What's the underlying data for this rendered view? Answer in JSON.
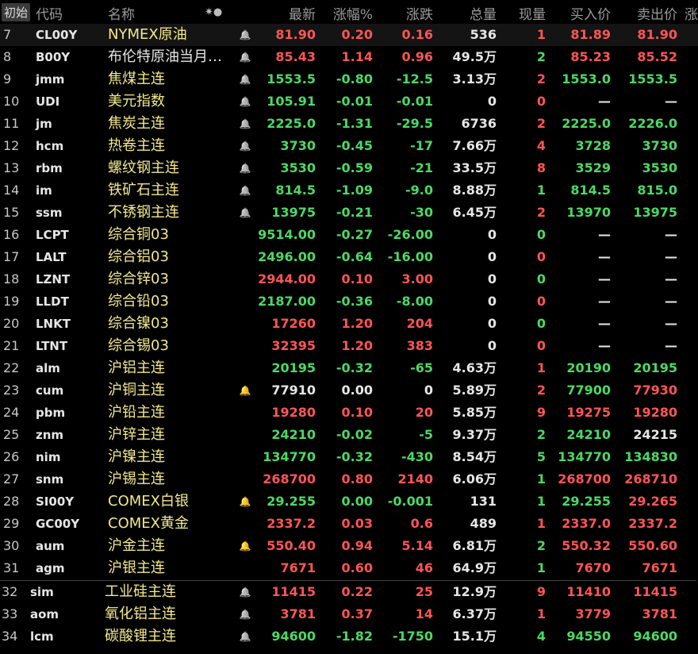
{
  "header": {
    "tag": "初始",
    "code": "代码",
    "name": "名称",
    "star": "✷●",
    "last": "最新",
    "pct": "涨幅%",
    "chg": "涨跌",
    "vol": "总量",
    "cur": "现量",
    "bid": "买入价",
    "ask": "卖出价",
    "extra": "涨"
  },
  "colors": {
    "up": "#ff5555",
    "down": "#4cd964",
    "flat": "#e6e6e6",
    "name_highlight": "#f3e98a",
    "bell_active": "#ff4422",
    "bell_idle": "#888888"
  },
  "rows": [
    {
      "idx": "7",
      "code": "CL00Y",
      "name": "NYMEX原油",
      "name_color": "yellow",
      "bell": "idle",
      "last": "81.90",
      "last_c": "red",
      "pct": "0.20",
      "pct_c": "red",
      "chg": "0.16",
      "chg_c": "red",
      "vol": "536",
      "cur": "1",
      "cur_c": "red",
      "bid": "81.89",
      "bid_c": "red",
      "ask": "81.90",
      "ask_c": "red"
    },
    {
      "idx": "8",
      "code": "B00Y",
      "name": "布伦特原油当月…",
      "name_color": "white",
      "bell": "idle",
      "last": "85.43",
      "last_c": "red",
      "pct": "1.14",
      "pct_c": "red",
      "chg": "0.96",
      "chg_c": "red",
      "vol": "49.5万",
      "cur": "2",
      "cur_c": "green",
      "bid": "85.23",
      "bid_c": "red",
      "ask": "85.52",
      "ask_c": "red"
    },
    {
      "idx": "9",
      "code": "jmm",
      "name": "焦煤主连",
      "name_color": "yellow",
      "bell": "idle",
      "last": "1553.5",
      "last_c": "green",
      "pct": "-0.80",
      "pct_c": "green",
      "chg": "-12.5",
      "chg_c": "green",
      "vol": "3.13万",
      "cur": "2",
      "cur_c": "red",
      "bid": "1553.0",
      "bid_c": "green",
      "ask": "1553.5",
      "ask_c": "green"
    },
    {
      "idx": "10",
      "code": "UDI",
      "name": "美元指数",
      "name_color": "yellow",
      "bell": "idle",
      "last": "105.91",
      "last_c": "green",
      "pct": "-0.01",
      "pct_c": "green",
      "chg": "-0.01",
      "chg_c": "green",
      "vol": "0",
      "cur": "0",
      "cur_c": "red",
      "bid": "—",
      "bid_c": "white",
      "ask": "—",
      "ask_c": "white"
    },
    {
      "idx": "11",
      "code": "jm",
      "name": "焦炭主连",
      "name_color": "yellow",
      "bell": "idle",
      "last": "2225.0",
      "last_c": "green",
      "pct": "-1.31",
      "pct_c": "green",
      "chg": "-29.5",
      "chg_c": "green",
      "vol": "6736",
      "cur": "2",
      "cur_c": "red",
      "bid": "2225.0",
      "bid_c": "green",
      "ask": "2226.0",
      "ask_c": "green"
    },
    {
      "idx": "12",
      "code": "hcm",
      "name": "热卷主连",
      "name_color": "yellow",
      "bell": "idle",
      "last": "3730",
      "last_c": "green",
      "pct": "-0.45",
      "pct_c": "green",
      "chg": "-17",
      "chg_c": "green",
      "vol": "7.66万",
      "cur": "4",
      "cur_c": "red",
      "bid": "3728",
      "bid_c": "green",
      "ask": "3730",
      "ask_c": "green"
    },
    {
      "idx": "13",
      "code": "rbm",
      "name": "螺纹钢主连",
      "name_color": "yellow",
      "bell": "idle",
      "last": "3530",
      "last_c": "green",
      "pct": "-0.59",
      "pct_c": "green",
      "chg": "-21",
      "chg_c": "green",
      "vol": "33.5万",
      "cur": "8",
      "cur_c": "red",
      "bid": "3529",
      "bid_c": "green",
      "ask": "3530",
      "ask_c": "green"
    },
    {
      "idx": "14",
      "code": "im",
      "name": "铁矿石主连",
      "name_color": "yellow",
      "bell": "idle",
      "last": "814.5",
      "last_c": "green",
      "pct": "-1.09",
      "pct_c": "green",
      "chg": "-9.0",
      "chg_c": "green",
      "vol": "8.88万",
      "cur": "1",
      "cur_c": "green",
      "bid": "814.5",
      "bid_c": "green",
      "ask": "815.0",
      "ask_c": "green"
    },
    {
      "idx": "15",
      "code": "ssm",
      "name": "不锈钢主连",
      "name_color": "yellow",
      "bell": "idle",
      "last": "13975",
      "last_c": "green",
      "pct": "-0.21",
      "pct_c": "green",
      "chg": "-30",
      "chg_c": "green",
      "vol": "6.45万",
      "cur": "2",
      "cur_c": "red",
      "bid": "13970",
      "bid_c": "green",
      "ask": "13975",
      "ask_c": "green"
    },
    {
      "idx": "16",
      "code": "LCPT",
      "name": "综合铜03",
      "name_color": "yellow",
      "bell": "none",
      "last": "9514.00",
      "last_c": "green",
      "pct": "-0.27",
      "pct_c": "green",
      "chg": "-26.00",
      "chg_c": "green",
      "vol": "0",
      "cur": "0",
      "cur_c": "green",
      "bid": "—",
      "bid_c": "white",
      "ask": "—",
      "ask_c": "white"
    },
    {
      "idx": "17",
      "code": "LALT",
      "name": "综合铝03",
      "name_color": "yellow",
      "bell": "none",
      "last": "2496.00",
      "last_c": "green",
      "pct": "-0.64",
      "pct_c": "green",
      "chg": "-16.00",
      "chg_c": "green",
      "vol": "0",
      "cur": "0",
      "cur_c": "red",
      "bid": "—",
      "bid_c": "white",
      "ask": "—",
      "ask_c": "white"
    },
    {
      "idx": "18",
      "code": "LZNT",
      "name": "综合锌03",
      "name_color": "yellow",
      "bell": "none",
      "last": "2944.00",
      "last_c": "red",
      "pct": "0.10",
      "pct_c": "red",
      "chg": "3.00",
      "chg_c": "red",
      "vol": "0",
      "cur": "0",
      "cur_c": "green",
      "bid": "—",
      "bid_c": "white",
      "ask": "—",
      "ask_c": "white"
    },
    {
      "idx": "19",
      "code": "LLDT",
      "name": "综合铅03",
      "name_color": "yellow",
      "bell": "none",
      "last": "2187.00",
      "last_c": "green",
      "pct": "-0.36",
      "pct_c": "green",
      "chg": "-8.00",
      "chg_c": "green",
      "vol": "0",
      "cur": "0",
      "cur_c": "red",
      "bid": "—",
      "bid_c": "white",
      "ask": "—",
      "ask_c": "white"
    },
    {
      "idx": "20",
      "code": "LNKT",
      "name": "综合镍03",
      "name_color": "yellow",
      "bell": "none",
      "last": "17260",
      "last_c": "red",
      "pct": "1.20",
      "pct_c": "red",
      "chg": "204",
      "chg_c": "red",
      "vol": "0",
      "cur": "0",
      "cur_c": "green",
      "bid": "—",
      "bid_c": "white",
      "ask": "—",
      "ask_c": "white"
    },
    {
      "idx": "21",
      "code": "LTNT",
      "name": "综合锡03",
      "name_color": "yellow",
      "bell": "none",
      "last": "32395",
      "last_c": "red",
      "pct": "1.20",
      "pct_c": "red",
      "chg": "383",
      "chg_c": "red",
      "vol": "0",
      "cur": "0",
      "cur_c": "red",
      "bid": "—",
      "bid_c": "white",
      "ask": "—",
      "ask_c": "white"
    },
    {
      "idx": "22",
      "code": "alm",
      "name": "沪铝主连",
      "name_color": "yellow",
      "bell": "none",
      "last": "20195",
      "last_c": "green",
      "pct": "-0.32",
      "pct_c": "green",
      "chg": "-65",
      "chg_c": "green",
      "vol": "4.63万",
      "cur": "1",
      "cur_c": "red",
      "bid": "20190",
      "bid_c": "green",
      "ask": "20195",
      "ask_c": "green"
    },
    {
      "idx": "23",
      "code": "cum",
      "name": "沪铜主连",
      "name_color": "yellow",
      "bell": "active",
      "last": "77910",
      "last_c": "white",
      "pct": "0.00",
      "pct_c": "white",
      "chg": "0",
      "chg_c": "white",
      "vol": "5.89万",
      "cur": "2",
      "cur_c": "red",
      "bid": "77900",
      "bid_c": "green",
      "ask": "77930",
      "ask_c": "red"
    },
    {
      "idx": "24",
      "code": "pbm",
      "name": "沪铅主连",
      "name_color": "yellow",
      "bell": "none",
      "last": "19280",
      "last_c": "red",
      "pct": "0.10",
      "pct_c": "red",
      "chg": "20",
      "chg_c": "red",
      "vol": "5.85万",
      "cur": "9",
      "cur_c": "red",
      "bid": "19275",
      "bid_c": "red",
      "ask": "19280",
      "ask_c": "red"
    },
    {
      "idx": "25",
      "code": "znm",
      "name": "沪锌主连",
      "name_color": "yellow",
      "bell": "none",
      "last": "24210",
      "last_c": "green",
      "pct": "-0.02",
      "pct_c": "green",
      "chg": "-5",
      "chg_c": "green",
      "vol": "9.37万",
      "cur": "2",
      "cur_c": "green",
      "bid": "24210",
      "bid_c": "green",
      "ask": "24215",
      "ask_c": "white"
    },
    {
      "idx": "26",
      "code": "nim",
      "name": "沪镍主连",
      "name_color": "yellow",
      "bell": "none",
      "last": "134770",
      "last_c": "green",
      "pct": "-0.32",
      "pct_c": "green",
      "chg": "-430",
      "chg_c": "green",
      "vol": "8.54万",
      "cur": "5",
      "cur_c": "green",
      "bid": "134770",
      "bid_c": "green",
      "ask": "134830",
      "ask_c": "green"
    },
    {
      "idx": "27",
      "code": "snm",
      "name": "沪锡主连",
      "name_color": "yellow",
      "bell": "none",
      "last": "268700",
      "last_c": "red",
      "pct": "0.80",
      "pct_c": "red",
      "chg": "2140",
      "chg_c": "red",
      "vol": "6.06万",
      "cur": "1",
      "cur_c": "green",
      "bid": "268700",
      "bid_c": "red",
      "ask": "268710",
      "ask_c": "red"
    },
    {
      "idx": "28",
      "code": "SI00Y",
      "name": "COMEX白银",
      "name_color": "yellow",
      "bell": "active",
      "last": "29.255",
      "last_c": "green",
      "pct": "0.00",
      "pct_c": "green",
      "chg": "-0.001",
      "chg_c": "green",
      "vol": "131",
      "cur": "1",
      "cur_c": "green",
      "bid": "29.255",
      "bid_c": "green",
      "ask": "29.265",
      "ask_c": "red"
    },
    {
      "idx": "29",
      "code": "GC00Y",
      "name": "COMEX黄金",
      "name_color": "yellow",
      "bell": "none",
      "last": "2337.2",
      "last_c": "red",
      "pct": "0.03",
      "pct_c": "red",
      "chg": "0.6",
      "chg_c": "red",
      "vol": "489",
      "cur": "1",
      "cur_c": "red",
      "bid": "2337.0",
      "bid_c": "red",
      "ask": "2337.2",
      "ask_c": "red"
    },
    {
      "idx": "30",
      "code": "aum",
      "name": "沪金主连",
      "name_color": "yellow",
      "bell": "active",
      "last": "550.40",
      "last_c": "red",
      "pct": "0.94",
      "pct_c": "red",
      "chg": "5.14",
      "chg_c": "red",
      "vol": "6.81万",
      "cur": "2",
      "cur_c": "green",
      "bid": "550.32",
      "bid_c": "red",
      "ask": "550.60",
      "ask_c": "red"
    },
    {
      "idx": "31",
      "code": "agm",
      "name": "沪银主连",
      "name_color": "yellow",
      "bell": "none",
      "last": "7671",
      "last_c": "red",
      "pct": "0.60",
      "pct_c": "red",
      "chg": "46",
      "chg_c": "red",
      "vol": "64.9万",
      "cur": "1",
      "cur_c": "green",
      "bid": "7670",
      "bid_c": "red",
      "ask": "7671",
      "ask_c": "red"
    }
  ],
  "rows2": [
    {
      "idx": "32",
      "code": "sim",
      "name": "工业硅主连",
      "name_color": "yellow",
      "bell": "idle",
      "last": "11415",
      "last_c": "red",
      "pct": "0.22",
      "pct_c": "red",
      "chg": "25",
      "chg_c": "red",
      "vol": "12.9万",
      "cur": "9",
      "cur_c": "red",
      "bid": "11410",
      "bid_c": "red",
      "ask": "11415",
      "ask_c": "red"
    },
    {
      "idx": "33",
      "code": "aom",
      "name": "氧化铝主连",
      "name_color": "yellow",
      "bell": "idle",
      "last": "3781",
      "last_c": "red",
      "pct": "0.37",
      "pct_c": "red",
      "chg": "14",
      "chg_c": "red",
      "vol": "6.37万",
      "cur": "1",
      "cur_c": "red",
      "bid": "3779",
      "bid_c": "red",
      "ask": "3781",
      "ask_c": "red"
    },
    {
      "idx": "34",
      "code": "lcm",
      "name": "碳酸锂主连",
      "name_color": "yellow",
      "bell": "idle",
      "last": "94600",
      "last_c": "green",
      "pct": "-1.82",
      "pct_c": "green",
      "chg": "-1750",
      "chg_c": "green",
      "vol": "15.1万",
      "cur": "4",
      "cur_c": "green",
      "bid": "94550",
      "bid_c": "green",
      "ask": "94600",
      "ask_c": "green"
    }
  ]
}
